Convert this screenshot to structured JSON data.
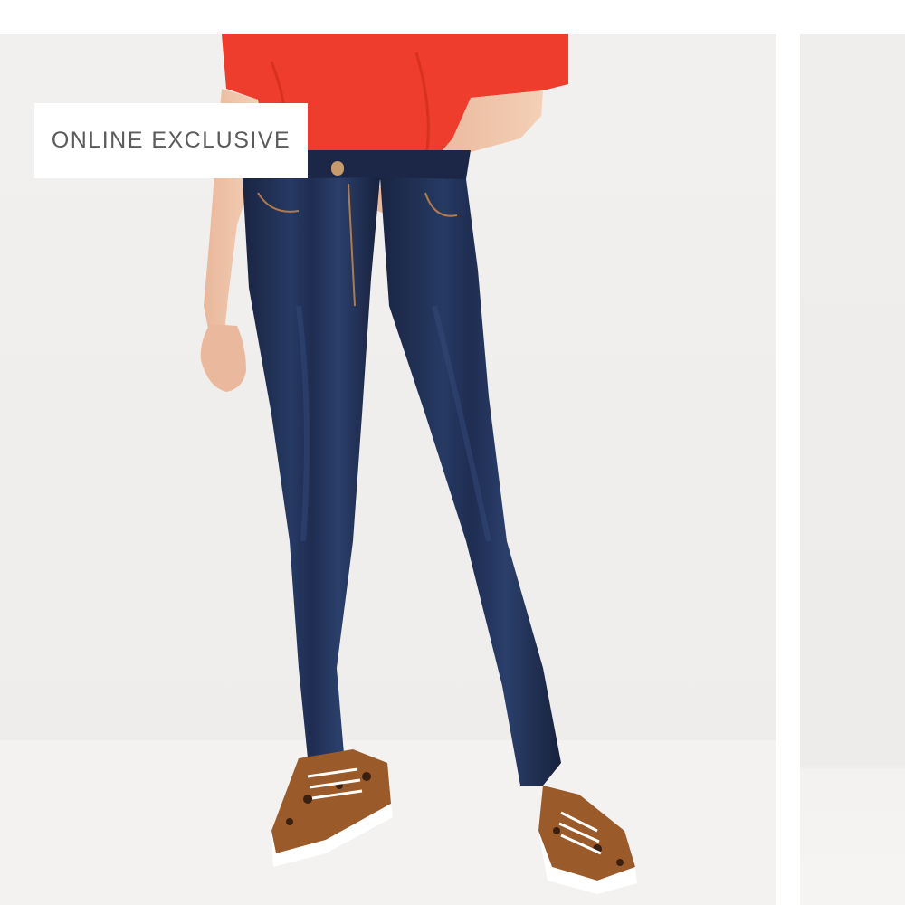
{
  "product_gallery": {
    "badge_label": "ONLINE EXCLUSIVE",
    "image_subject": "model wearing dark wash skinny jeans, red top and leopard print sneakers"
  },
  "colors": {
    "background": "#ffffff",
    "photo_backdrop": "#f0eeec",
    "top": "#ee3d2c",
    "denim": "#1f2b4d",
    "badge_text": "#5b5b5b"
  },
  "icons": []
}
